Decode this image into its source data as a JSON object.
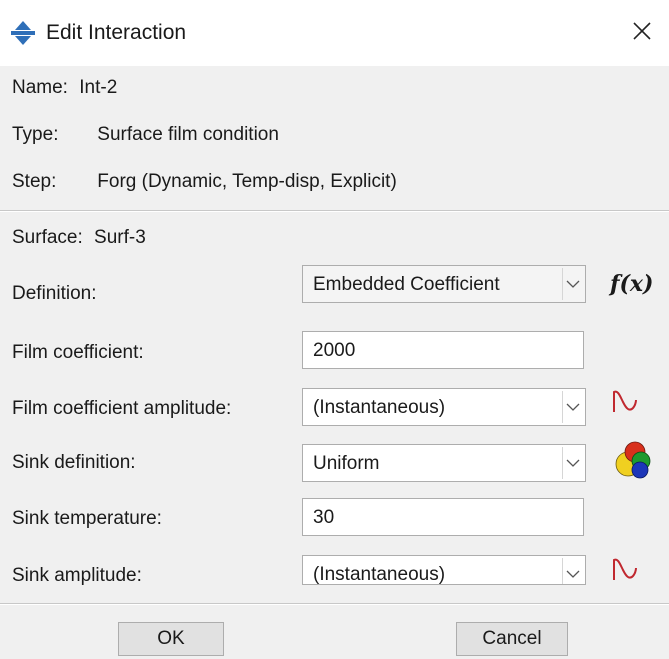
{
  "window": {
    "title": "Edit Interaction",
    "title_icon": "abaqus-interaction-icon",
    "close_icon": "close-icon"
  },
  "info": {
    "name_label": "Name:",
    "name_value": "Int-2",
    "type_label": "Type:",
    "type_value": "Surface film condition",
    "step_label": "Step:",
    "step_value": "Forg (Dynamic, Temp-disp, Explicit)"
  },
  "surface": {
    "label": "Surface:",
    "value": "Surf-3"
  },
  "form": {
    "definition": {
      "label": "Definition:",
      "value": "Embedded Coefficient",
      "icon_text": "f(x)"
    },
    "film_coefficient": {
      "label": "Film coefficient:",
      "value": "2000"
    },
    "film_coefficient_amplitude": {
      "label": "Film coefficient amplitude:",
      "value": "(Instantaneous)",
      "icon": "amplitude-icon"
    },
    "sink_definition": {
      "label": "Sink definition:",
      "value": "Uniform",
      "icon": "analytical-field-icon"
    },
    "sink_temperature": {
      "label": "Sink temperature:",
      "value": "30"
    },
    "sink_amplitude": {
      "label": "Sink amplitude:",
      "value": "(Instantaneous)",
      "icon": "amplitude-icon"
    }
  },
  "buttons": {
    "ok": "OK",
    "cancel": "Cancel"
  },
  "colors": {
    "amplitude_icon": "#c0282f",
    "field_icon_yellow": "#f0d020",
    "field_icon_red": "#d8301c",
    "field_icon_green": "#1e9a2e",
    "field_icon_blue": "#1c36b8"
  }
}
